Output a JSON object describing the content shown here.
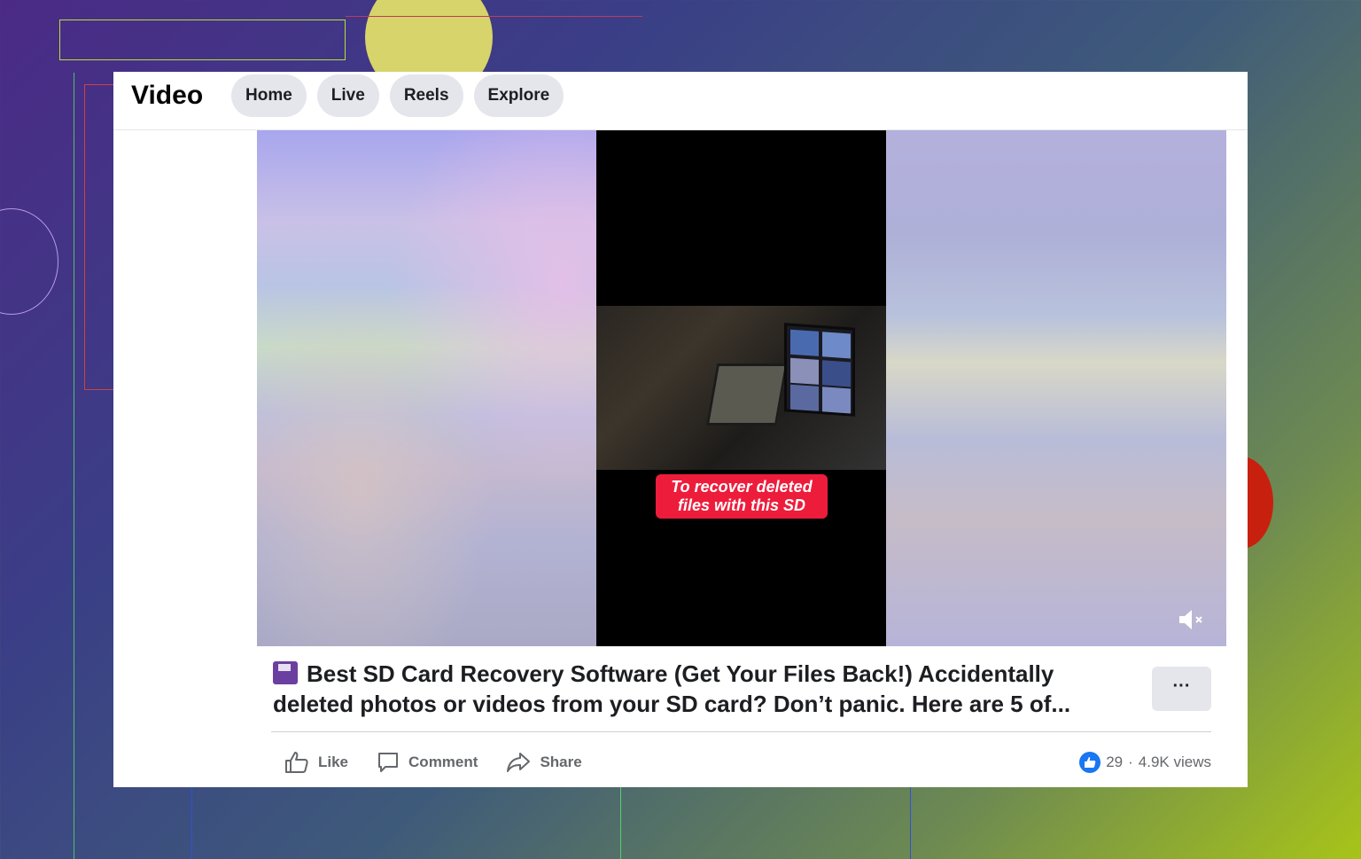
{
  "header": {
    "title": "Video",
    "tabs": [
      {
        "label": "Home"
      },
      {
        "label": "Live"
      },
      {
        "label": "Reels"
      },
      {
        "label": "Explore"
      }
    ]
  },
  "video": {
    "caption_line1": "To recover deleted",
    "caption_line2": "files with this SD",
    "mute_icon": "volume-muted-icon"
  },
  "post": {
    "title_emoji": "floppy-disk-icon",
    "title_line1": "Best SD Card Recovery Software (Get Your Files Back!) Accidentally",
    "title_line2": "deleted photos or videos from your SD card? Don’t panic. Here are 5 of...",
    "more_label": "···"
  },
  "actions": {
    "like_label": "Like",
    "comment_label": "Comment",
    "share_label": "Share"
  },
  "stats": {
    "reactions_count": "29",
    "separator": "·",
    "views": "4.9K views"
  },
  "colors": {
    "accent": "#1877f2",
    "caption_bg": "#ee1c3b",
    "tab_bg": "#e4e6eb"
  }
}
